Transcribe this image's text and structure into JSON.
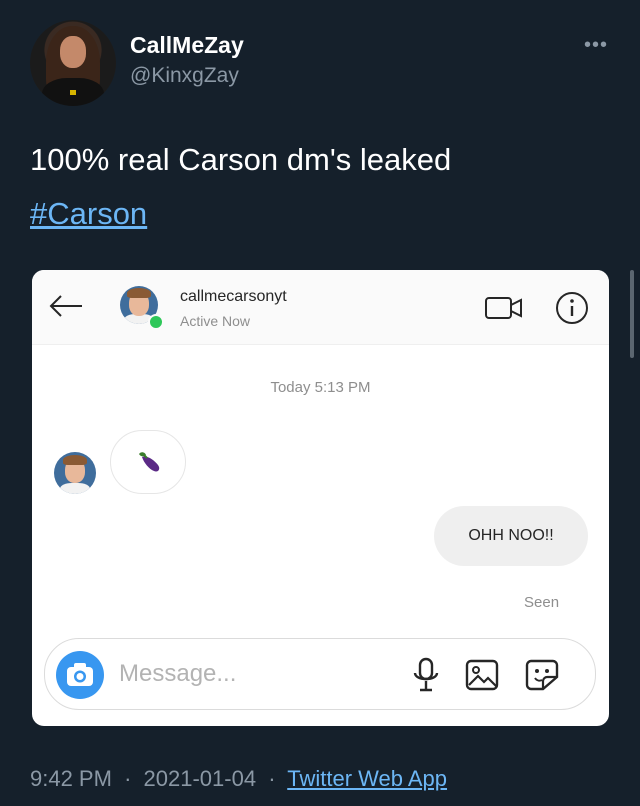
{
  "tweet": {
    "author_name": "CallMeZay",
    "author_handle": "@KinxgZay",
    "more_label": "•••",
    "text": "100% real Carson dm's leaked",
    "hashtag": "#Carson",
    "time": "9:42 PM",
    "date": "2021-01-04",
    "separator": "·",
    "source": "Twitter Web App"
  },
  "dm": {
    "username": "callmecarsonyt",
    "status": "Active Now",
    "timestamp": "Today 5:13 PM",
    "incoming_emoji": "eggplant",
    "outgoing_message": "OHH NOO!!",
    "seen": "Seen",
    "input_placeholder": "Message..."
  },
  "colors": {
    "background": "#15202b",
    "link": "#6cb6f5",
    "secondary_text": "#8b98a5",
    "online": "#2ec759",
    "camera": "#3897f0"
  },
  "icons": [
    "back-arrow-icon",
    "video-call-icon",
    "info-icon",
    "eggplant-icon",
    "camera-icon",
    "microphone-icon",
    "image-icon",
    "sticker-icon",
    "more-options-icon"
  ]
}
